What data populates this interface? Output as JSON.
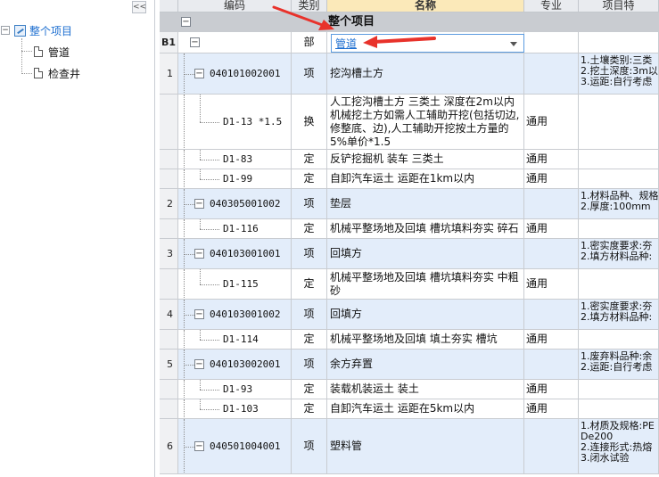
{
  "tree": {
    "collapse_label": "<<",
    "root_toggle": "−",
    "root_label": "整个项目",
    "children": [
      "管道",
      "检查井"
    ]
  },
  "grid": {
    "headers": {
      "code": "编码",
      "category": "类别",
      "name": "名称",
      "major": "专业",
      "feature": "项目特"
    },
    "project_row": {
      "toggle": "−",
      "label": "整个项目"
    },
    "section_row": {
      "num": "B1",
      "toggle": "−",
      "category": "部",
      "name_value": "管道"
    },
    "rows": [
      {
        "num": "1",
        "toggle": "−",
        "code": "040101002001",
        "category": "项",
        "name": "挖沟槽土方",
        "major": "",
        "feature": "1.土壤类别:三类\n2.挖土深度:3m以\n3.运距:自行考虑"
      },
      {
        "num": "",
        "toggle": "",
        "code": "D1-13 *1.5",
        "category": "换",
        "name": "人工挖沟槽土方 三类土 深度在2m以内 机械挖土方如需人工辅助开挖(包括切边,修整底、边),人工辅助开挖按土方量的5%单价*1.5",
        "major": "通用",
        "feature": ""
      },
      {
        "num": "",
        "toggle": "",
        "code": "D1-83",
        "category": "定",
        "name": "反铲挖掘机 装车 三类土",
        "major": "通用",
        "feature": ""
      },
      {
        "num": "",
        "toggle": "",
        "code": "D1-99",
        "category": "定",
        "name": "自卸汽车运土 运距在1km以内",
        "major": "通用",
        "feature": ""
      },
      {
        "num": "2",
        "toggle": "−",
        "code": "040305001002",
        "category": "项",
        "name": "垫层",
        "major": "",
        "feature": "1.材料品种、规格\n2.厚度:100mm"
      },
      {
        "num": "",
        "toggle": "",
        "code": "D1-116",
        "category": "定",
        "name": "机械平整场地及回填 槽坑填料夯实 碎石",
        "major": "通用",
        "feature": ""
      },
      {
        "num": "3",
        "toggle": "−",
        "code": "040103001001",
        "category": "项",
        "name": "回填方",
        "major": "",
        "feature": "1.密实度要求:夯\n2.填方材料品种:"
      },
      {
        "num": "",
        "toggle": "",
        "code": "D1-115",
        "category": "定",
        "name": "机械平整场地及回填 槽坑填料夯实 中粗砂",
        "major": "通用",
        "feature": ""
      },
      {
        "num": "4",
        "toggle": "−",
        "code": "040103001002",
        "category": "项",
        "name": "回填方",
        "major": "",
        "feature": "1.密实度要求:夯\n2.填方材料品种:"
      },
      {
        "num": "",
        "toggle": "",
        "code": "D1-114",
        "category": "定",
        "name": "机械平整场地及回填 填土夯实 槽坑",
        "major": "通用",
        "feature": ""
      },
      {
        "num": "5",
        "toggle": "−",
        "code": "040103002001",
        "category": "项",
        "name": "余方弃置",
        "major": "",
        "feature": "1.废弃料品种:余\n2.运距:自行考虑"
      },
      {
        "num": "",
        "toggle": "",
        "code": "D1-93",
        "category": "定",
        "name": "装载机装运土 装土",
        "major": "通用",
        "feature": ""
      },
      {
        "num": "",
        "toggle": "",
        "code": "D1-103",
        "category": "定",
        "name": "自卸汽车运土 运距在5km以内",
        "major": "通用",
        "feature": ""
      },
      {
        "num": "6",
        "toggle": "−",
        "code": "040501004001",
        "category": "项",
        "name": "塑料管",
        "major": "",
        "feature": "1.材质及规格:PE\nDe200\n2.连接形式:热熔\n3.闭水试验"
      }
    ]
  },
  "colors": {
    "accent_blue": "#1e6fd0",
    "row_blue": "#e3edfa",
    "header_highlight": "#fbe9b9",
    "annotation_red": "#e8322b"
  },
  "icons": {
    "collapse": "double-chevron-left-icon",
    "root": "project-icon",
    "child": "document-icon",
    "toggle": "minus-box-icon",
    "dropdown": "chevron-down-icon",
    "annotation": "red-arrow-icon"
  }
}
